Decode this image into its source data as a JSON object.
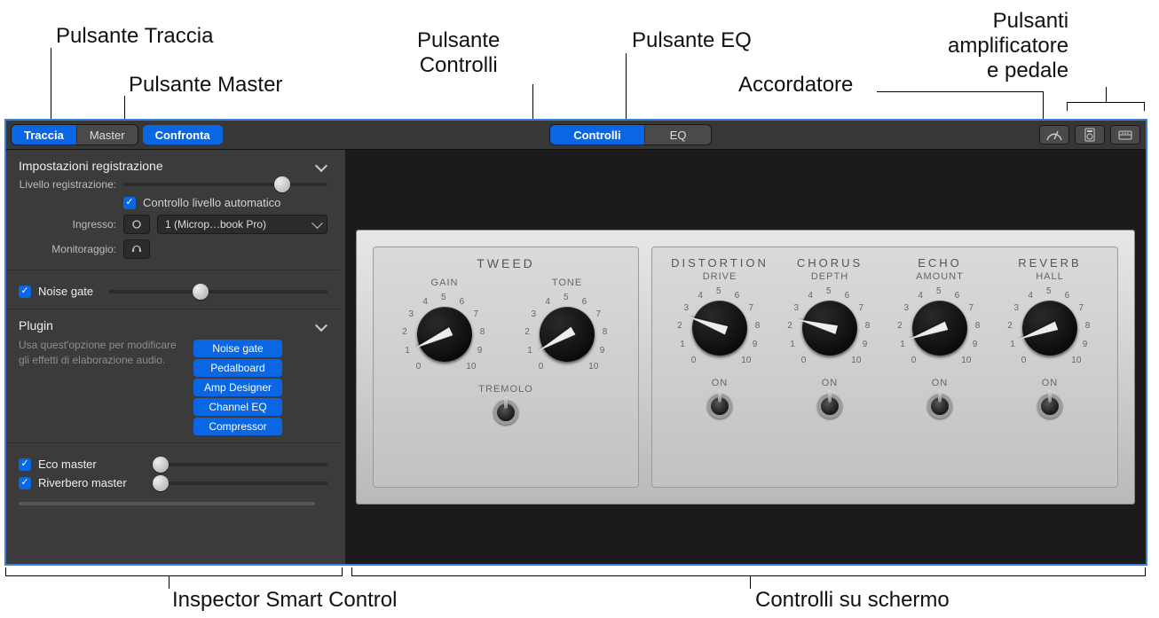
{
  "callouts": {
    "track_button": "Pulsante Traccia",
    "master_button": "Pulsante Master",
    "controls_button": "Pulsante\nControlli",
    "eq_button": "Pulsante EQ",
    "tuner": "Accordatore",
    "amp_pedal_buttons": "Pulsanti\namplificatore\ne pedale",
    "inspector": "Inspector Smart Control",
    "screen_controls": "Controlli su schermo"
  },
  "toolbar": {
    "segments_left": [
      {
        "label": "Traccia",
        "active": true
      },
      {
        "label": "Master",
        "active": false
      }
    ],
    "compare": "Confronta",
    "segments_center": [
      {
        "label": "Controlli",
        "active": true
      },
      {
        "label": "EQ",
        "active": false
      }
    ]
  },
  "inspector": {
    "recording": {
      "title": "Impostazioni registrazione",
      "level_label": "Livello registrazione:",
      "auto_level": "Controllo livello automatico",
      "input_label": "Ingresso:",
      "input_value": "1 (Microp…book Pro)",
      "monitoring_label": "Monitoraggio:"
    },
    "noise_gate": {
      "label": "Noise gate"
    },
    "plugin": {
      "title": "Plugin",
      "desc": "Usa quest'opzione per modificare gli effetti di elaborazione audio.",
      "items": [
        "Noise gate",
        "Pedalboard",
        "Amp Designer",
        "Channel EQ",
        "Compressor"
      ]
    },
    "eco_master": {
      "label": "Eco master"
    },
    "reverb_master": {
      "label": "Riverbero master"
    }
  },
  "amp": {
    "left": {
      "title": "TWEED",
      "knobs": [
        {
          "name": "GAIN"
        },
        {
          "name": "TONE"
        }
      ],
      "toggle": "TREMOLO"
    },
    "right": {
      "knobs": [
        {
          "title": "DISTORTION",
          "name": "DRIVE"
        },
        {
          "title": "CHORUS",
          "name": "DEPTH"
        },
        {
          "title": "ECHO",
          "name": "AMOUNT"
        },
        {
          "title": "REVERB",
          "name": "HALL"
        }
      ],
      "toggle": "ON"
    },
    "ticks": [
      "0",
      "1",
      "2",
      "3",
      "4",
      "5",
      "6",
      "7",
      "8",
      "9",
      "10"
    ]
  }
}
